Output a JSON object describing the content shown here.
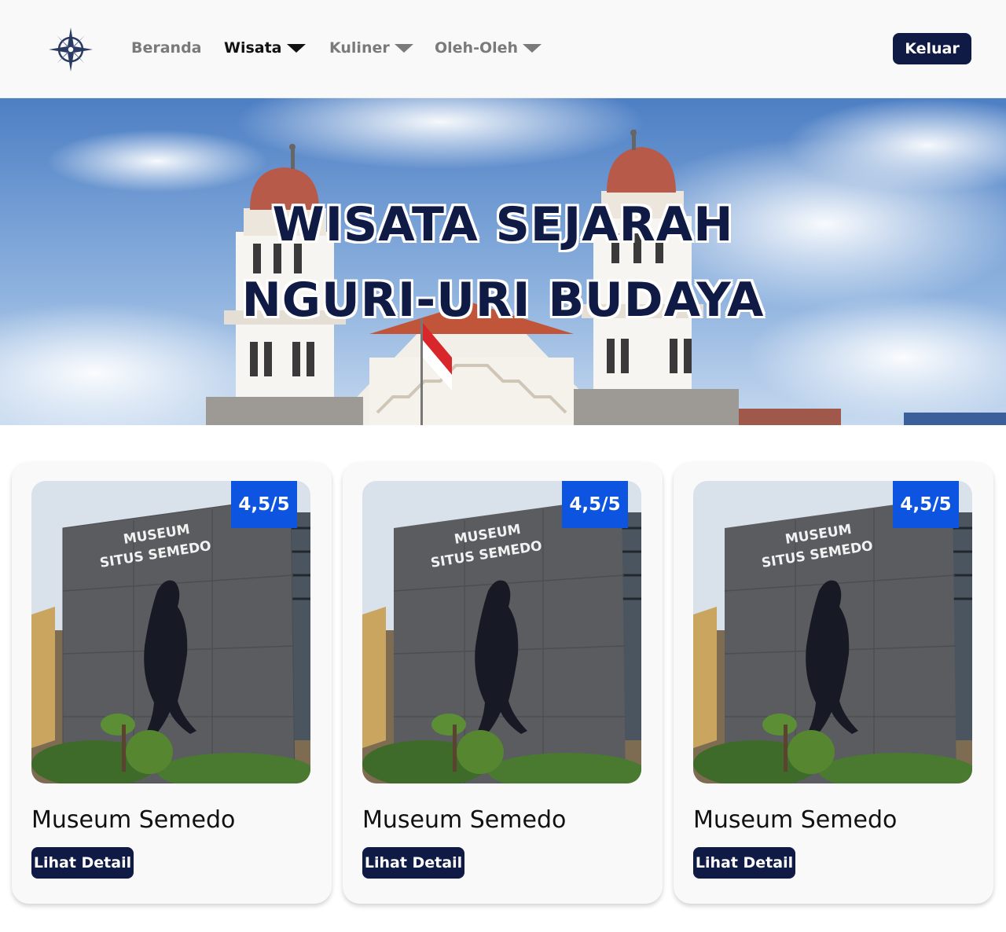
{
  "navbar": {
    "logo_icon": "compass-rose-icon",
    "items": [
      {
        "label": "Beranda",
        "active": false,
        "dropdown": false
      },
      {
        "label": "Wisata",
        "active": true,
        "dropdown": true
      },
      {
        "label": "Kuliner",
        "active": false,
        "dropdown": true
      },
      {
        "label": "Oleh-Oleh",
        "active": false,
        "dropdown": true
      }
    ],
    "logout_label": "Keluar"
  },
  "hero": {
    "title_line1": "WISATA SEJARAH",
    "title_line2": "NGURI-URI BUDAYA"
  },
  "cards": [
    {
      "title": "Museum Semedo",
      "rating": "4,5/5",
      "button_label": "Lihat Detail",
      "image_text_1": "MUSEUM",
      "image_text_2": "SITUS SEMEDO"
    },
    {
      "title": "Museum Semedo",
      "rating": "4,5/5",
      "button_label": "Lihat Detail",
      "image_text_1": "MUSEUM",
      "image_text_2": "SITUS SEMEDO"
    },
    {
      "title": "Museum Semedo",
      "rating": "4,5/5",
      "button_label": "Lihat Detail",
      "image_text_1": "MUSEUM",
      "image_text_2": "SITUS SEMEDO"
    }
  ],
  "colors": {
    "navy": "#0f1b45",
    "rating_blue": "#0d55e0",
    "nav_inactive": "#7a7a7a"
  }
}
